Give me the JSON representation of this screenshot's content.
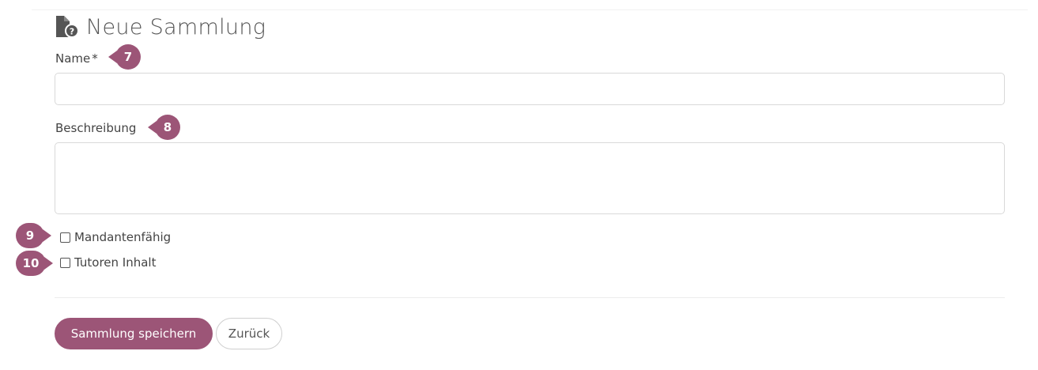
{
  "page": {
    "title": "Neue Sammlung",
    "title_icon": "file-question-icon"
  },
  "form": {
    "name_label": "Name",
    "name_required_mark": "*",
    "name_value": "",
    "description_label": "Beschreibung",
    "description_value": "",
    "checkboxes": [
      {
        "label": "Mandantenfähig",
        "checked": false
      },
      {
        "label": "Tutoren Inhalt",
        "checked": false
      }
    ]
  },
  "markers": {
    "name": "7",
    "description": "8",
    "mandantenfaehig": "9",
    "tutoren": "10"
  },
  "actions": {
    "save_label": "Sammlung speichern",
    "back_label": "Zurück"
  },
  "colors": {
    "accent": "#9c5577",
    "text": "#444444",
    "border": "#d9d9d9"
  }
}
